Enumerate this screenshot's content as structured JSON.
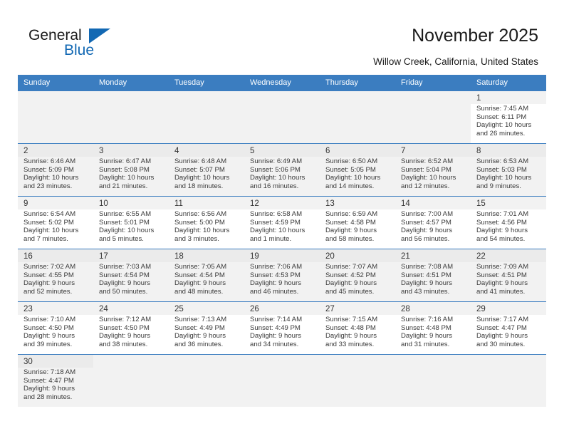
{
  "brand": {
    "name_top": "General",
    "name_bottom": "Blue",
    "triangle_icon": "triangle-icon",
    "accent_color": "#1268b3"
  },
  "header": {
    "title": "November 2025",
    "subtitle": "Willow Creek, California, United States"
  },
  "theme": {
    "header_bg": "#3b7dc0",
    "header_text": "#ffffff",
    "cell_shade": "#f2f2f2",
    "cell_white": "#ffffff",
    "text": "#3a3a3a"
  },
  "calendar": {
    "weekday_headers": [
      "Sunday",
      "Monday",
      "Tuesday",
      "Wednesday",
      "Thursday",
      "Friday",
      "Saturday"
    ],
    "weeks": [
      [
        {
          "empty": true
        },
        {
          "empty": true
        },
        {
          "empty": true
        },
        {
          "empty": true
        },
        {
          "empty": true
        },
        {
          "empty": true
        },
        {
          "day": "1",
          "sunrise": "Sunrise: 7:45 AM",
          "sunset": "Sunset: 6:11 PM",
          "daylight_1": "Daylight: 10 hours",
          "daylight_2": "and 26 minutes."
        }
      ],
      [
        {
          "day": "2",
          "sunrise": "Sunrise: 6:46 AM",
          "sunset": "Sunset: 5:09 PM",
          "daylight_1": "Daylight: 10 hours",
          "daylight_2": "and 23 minutes."
        },
        {
          "day": "3",
          "sunrise": "Sunrise: 6:47 AM",
          "sunset": "Sunset: 5:08 PM",
          "daylight_1": "Daylight: 10 hours",
          "daylight_2": "and 21 minutes."
        },
        {
          "day": "4",
          "sunrise": "Sunrise: 6:48 AM",
          "sunset": "Sunset: 5:07 PM",
          "daylight_1": "Daylight: 10 hours",
          "daylight_2": "and 18 minutes."
        },
        {
          "day": "5",
          "sunrise": "Sunrise: 6:49 AM",
          "sunset": "Sunset: 5:06 PM",
          "daylight_1": "Daylight: 10 hours",
          "daylight_2": "and 16 minutes."
        },
        {
          "day": "6",
          "sunrise": "Sunrise: 6:50 AM",
          "sunset": "Sunset: 5:05 PM",
          "daylight_1": "Daylight: 10 hours",
          "daylight_2": "and 14 minutes."
        },
        {
          "day": "7",
          "sunrise": "Sunrise: 6:52 AM",
          "sunset": "Sunset: 5:04 PM",
          "daylight_1": "Daylight: 10 hours",
          "daylight_2": "and 12 minutes."
        },
        {
          "day": "8",
          "sunrise": "Sunrise: 6:53 AM",
          "sunset": "Sunset: 5:03 PM",
          "daylight_1": "Daylight: 10 hours",
          "daylight_2": "and 9 minutes."
        }
      ],
      [
        {
          "day": "9",
          "sunrise": "Sunrise: 6:54 AM",
          "sunset": "Sunset: 5:02 PM",
          "daylight_1": "Daylight: 10 hours",
          "daylight_2": "and 7 minutes."
        },
        {
          "day": "10",
          "sunrise": "Sunrise: 6:55 AM",
          "sunset": "Sunset: 5:01 PM",
          "daylight_1": "Daylight: 10 hours",
          "daylight_2": "and 5 minutes."
        },
        {
          "day": "11",
          "sunrise": "Sunrise: 6:56 AM",
          "sunset": "Sunset: 5:00 PM",
          "daylight_1": "Daylight: 10 hours",
          "daylight_2": "and 3 minutes."
        },
        {
          "day": "12",
          "sunrise": "Sunrise: 6:58 AM",
          "sunset": "Sunset: 4:59 PM",
          "daylight_1": "Daylight: 10 hours",
          "daylight_2": "and 1 minute."
        },
        {
          "day": "13",
          "sunrise": "Sunrise: 6:59 AM",
          "sunset": "Sunset: 4:58 PM",
          "daylight_1": "Daylight: 9 hours",
          "daylight_2": "and 58 minutes."
        },
        {
          "day": "14",
          "sunrise": "Sunrise: 7:00 AM",
          "sunset": "Sunset: 4:57 PM",
          "daylight_1": "Daylight: 9 hours",
          "daylight_2": "and 56 minutes."
        },
        {
          "day": "15",
          "sunrise": "Sunrise: 7:01 AM",
          "sunset": "Sunset: 4:56 PM",
          "daylight_1": "Daylight: 9 hours",
          "daylight_2": "and 54 minutes."
        }
      ],
      [
        {
          "day": "16",
          "sunrise": "Sunrise: 7:02 AM",
          "sunset": "Sunset: 4:55 PM",
          "daylight_1": "Daylight: 9 hours",
          "daylight_2": "and 52 minutes."
        },
        {
          "day": "17",
          "sunrise": "Sunrise: 7:03 AM",
          "sunset": "Sunset: 4:54 PM",
          "daylight_1": "Daylight: 9 hours",
          "daylight_2": "and 50 minutes."
        },
        {
          "day": "18",
          "sunrise": "Sunrise: 7:05 AM",
          "sunset": "Sunset: 4:54 PM",
          "daylight_1": "Daylight: 9 hours",
          "daylight_2": "and 48 minutes."
        },
        {
          "day": "19",
          "sunrise": "Sunrise: 7:06 AM",
          "sunset": "Sunset: 4:53 PM",
          "daylight_1": "Daylight: 9 hours",
          "daylight_2": "and 46 minutes."
        },
        {
          "day": "20",
          "sunrise": "Sunrise: 7:07 AM",
          "sunset": "Sunset: 4:52 PM",
          "daylight_1": "Daylight: 9 hours",
          "daylight_2": "and 45 minutes."
        },
        {
          "day": "21",
          "sunrise": "Sunrise: 7:08 AM",
          "sunset": "Sunset: 4:51 PM",
          "daylight_1": "Daylight: 9 hours",
          "daylight_2": "and 43 minutes."
        },
        {
          "day": "22",
          "sunrise": "Sunrise: 7:09 AM",
          "sunset": "Sunset: 4:51 PM",
          "daylight_1": "Daylight: 9 hours",
          "daylight_2": "and 41 minutes."
        }
      ],
      [
        {
          "day": "23",
          "sunrise": "Sunrise: 7:10 AM",
          "sunset": "Sunset: 4:50 PM",
          "daylight_1": "Daylight: 9 hours",
          "daylight_2": "and 39 minutes."
        },
        {
          "day": "24",
          "sunrise": "Sunrise: 7:12 AM",
          "sunset": "Sunset: 4:50 PM",
          "daylight_1": "Daylight: 9 hours",
          "daylight_2": "and 38 minutes."
        },
        {
          "day": "25",
          "sunrise": "Sunrise: 7:13 AM",
          "sunset": "Sunset: 4:49 PM",
          "daylight_1": "Daylight: 9 hours",
          "daylight_2": "and 36 minutes."
        },
        {
          "day": "26",
          "sunrise": "Sunrise: 7:14 AM",
          "sunset": "Sunset: 4:49 PM",
          "daylight_1": "Daylight: 9 hours",
          "daylight_2": "and 34 minutes."
        },
        {
          "day": "27",
          "sunrise": "Sunrise: 7:15 AM",
          "sunset": "Sunset: 4:48 PM",
          "daylight_1": "Daylight: 9 hours",
          "daylight_2": "and 33 minutes."
        },
        {
          "day": "28",
          "sunrise": "Sunrise: 7:16 AM",
          "sunset": "Sunset: 4:48 PM",
          "daylight_1": "Daylight: 9 hours",
          "daylight_2": "and 31 minutes."
        },
        {
          "day": "29",
          "sunrise": "Sunrise: 7:17 AM",
          "sunset": "Sunset: 4:47 PM",
          "daylight_1": "Daylight: 9 hours",
          "daylight_2": "and 30 minutes."
        }
      ],
      [
        {
          "day": "30",
          "sunrise": "Sunrise: 7:18 AM",
          "sunset": "Sunset: 4:47 PM",
          "daylight_1": "Daylight: 9 hours",
          "daylight_2": "and 28 minutes."
        },
        {
          "empty": true
        },
        {
          "empty": true
        },
        {
          "empty": true
        },
        {
          "empty": true
        },
        {
          "empty": true
        },
        {
          "empty": true
        }
      ]
    ]
  }
}
